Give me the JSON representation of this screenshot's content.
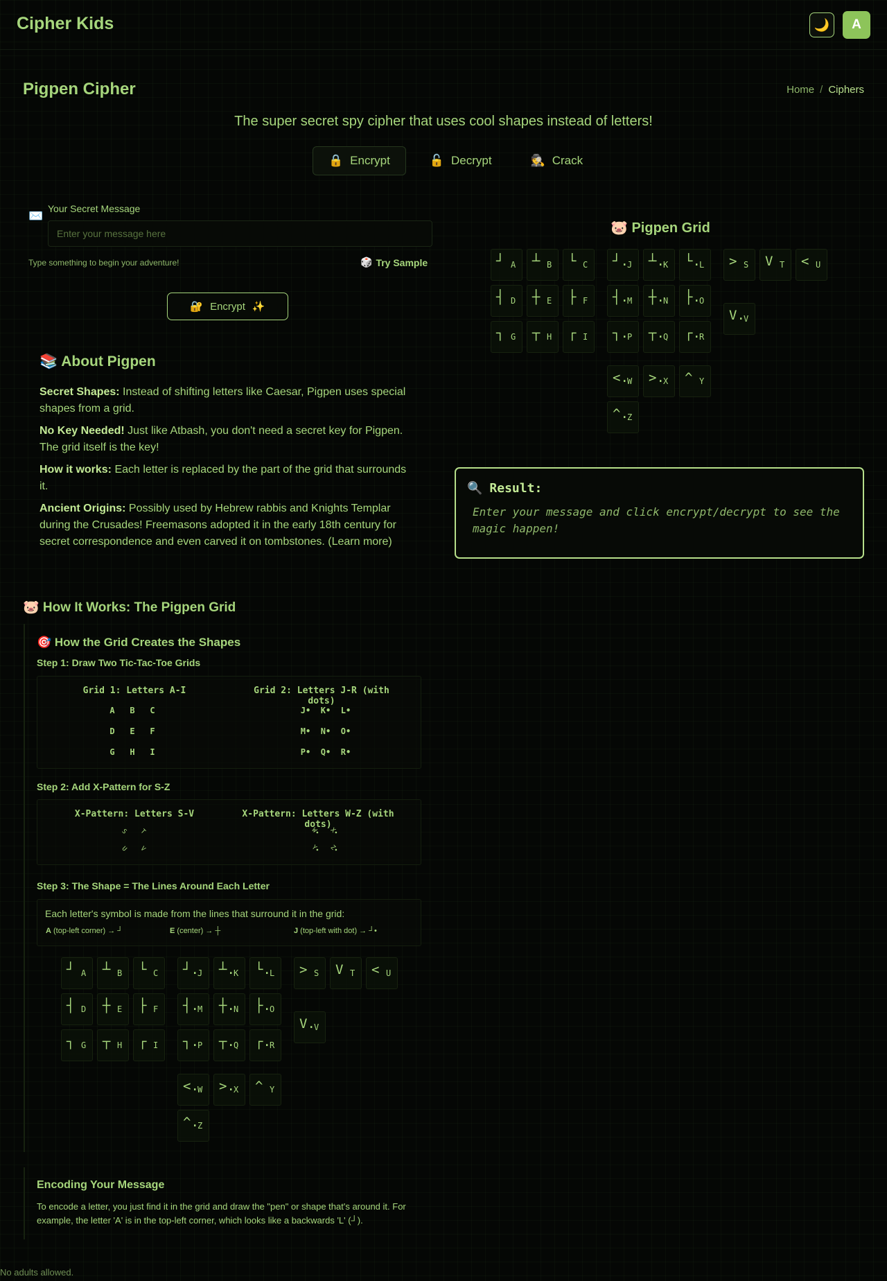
{
  "app": {
    "brand": "Cipher Kids",
    "theme_icon": "🌙",
    "avatar": "A"
  },
  "page": {
    "title": "Pigpen Cipher",
    "subtitle": "The super secret spy cipher that uses cool shapes instead of letters!"
  },
  "breadcrumb": {
    "home": "Home",
    "sep": "/",
    "current": "Ciphers"
  },
  "tabs": [
    {
      "icon": "🔒",
      "label": "Encrypt"
    },
    {
      "icon": "🔓",
      "label": "Decrypt"
    },
    {
      "icon": "🕵️",
      "label": "Crack"
    }
  ],
  "form": {
    "icon": "✉️",
    "label": "Your Secret Message",
    "placeholder": "Enter your message here",
    "value": "",
    "hint": "Type something to begin your adventure!",
    "sample_icon": "🎲",
    "sample_label": "Try Sample",
    "button_icon_left": "🔐",
    "button_label": "Encrypt",
    "button_icon_right": "✨"
  },
  "about": {
    "title": "📚 About Pigpen",
    "items": [
      {
        "term": "Secret Shapes:",
        "text": " Instead of shifting letters like Caesar, Pigpen uses special shapes from a grid."
      },
      {
        "term": "No Key Needed!",
        "text": " Just like Atbash, you don't need a secret key for Pigpen. The grid itself is the key!"
      },
      {
        "term": "How it works:",
        "text": " Each letter is replaced by the part of the grid that surrounds it."
      },
      {
        "term": "Ancient Origins:",
        "text": " Possibly used by Hebrew rabbis and Knights Templar during the Crusades! Freemasons adopted it in the early 18th century for secret correspondence and even carved it on tombstones. (Learn more)"
      }
    ]
  },
  "pigpen_grid": {
    "title": "🐷 Pigpen Grid"
  },
  "result": {
    "icon": "🔍",
    "title": "Result:",
    "placeholder": "Enter your message and click encrypt/decrypt to see the magic happen!"
  },
  "symbols": [
    {
      "sym": "┘",
      "letter": "A"
    },
    {
      "sym": "┴",
      "letter": "B"
    },
    {
      "sym": "└",
      "letter": "C"
    },
    {
      "sym": "┤",
      "letter": "D"
    },
    {
      "sym": "┼",
      "letter": "E"
    },
    {
      "sym": "├",
      "letter": "F"
    },
    {
      "sym": "┐",
      "letter": "G"
    },
    {
      "sym": "┬",
      "letter": "H"
    },
    {
      "sym": "┌",
      "letter": "I"
    },
    {
      "sym": "┘.",
      "letter": "J"
    },
    {
      "sym": "┴.",
      "letter": "K"
    },
    {
      "sym": "└.",
      "letter": "L"
    },
    {
      "sym": "┤.",
      "letter": "M"
    },
    {
      "sym": "┼.",
      "letter": "N"
    },
    {
      "sym": "├.",
      "letter": "O"
    },
    {
      "sym": "┐.",
      "letter": "P"
    },
    {
      "sym": "┬.",
      "letter": "Q"
    },
    {
      "sym": "┌.",
      "letter": "R"
    },
    {
      "sym": ">",
      "letter": "S"
    },
    {
      "sym": "V",
      "letter": "T"
    },
    {
      "sym": "<",
      "letter": "U"
    },
    {
      "sym": "V.",
      "letter": "V"
    },
    {
      "sym": "<.",
      "letter": "W"
    },
    {
      "sym": ">.",
      "letter": "X"
    },
    {
      "sym": "^",
      "letter": "Y"
    },
    {
      "sym": "^.",
      "letter": "Z"
    }
  ],
  "how": {
    "title": "🐷 How It Works: The Pigpen Grid",
    "subtitle": "🎯 How the Grid Creates the Shapes",
    "step1": "Step 1: Draw Two Tic-Tac-Toe Grids",
    "grid1_title": "Grid 1: Letters A-I",
    "grid1": [
      "A",
      "B",
      "C",
      "D",
      "E",
      "F",
      "G",
      "H",
      "I"
    ],
    "grid2_title": "Grid 2: Letters J-R (with dots)",
    "grid2": [
      "J•",
      "K•",
      "L•",
      "M•",
      "N•",
      "O•",
      "P•",
      "Q•",
      "R•"
    ],
    "step2": "Step 2: Add X-Pattern for S-Z",
    "x1_title": "X-Pattern: Letters S-V",
    "x1": [
      "S",
      "T",
      "U",
      "V"
    ],
    "x2_title": "X-Pattern: Letters W-Z (with dots)",
    "x2": [
      "W•",
      "X•",
      "Y•",
      "Z•"
    ],
    "step3": "Step 3: The Shape = The Lines Around Each Letter",
    "explain": "Each letter's symbol is made from the lines that surround it in the grid:",
    "examples": [
      {
        "b": "A",
        "t": " (top-left corner) → ┘"
      },
      {
        "b": "E",
        "t": " (center) → ┼"
      },
      {
        "b": "J",
        "t": " (top-left with dot) → ┘•"
      }
    ]
  },
  "encode": {
    "title": "Encoding Your Message",
    "text": "To encode a letter, you just find it in the grid and draw the \"pen\" or shape that's around it. For example, the letter 'A' is in the top-left corner, which looks like a backwards 'L' (┘)."
  },
  "footer": "No adults allowed."
}
